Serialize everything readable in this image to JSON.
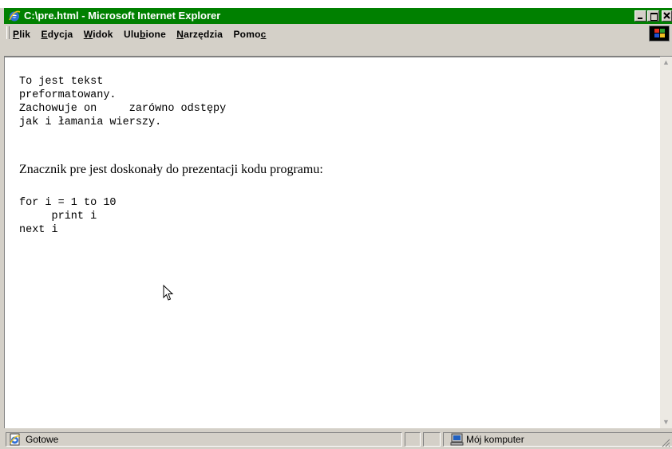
{
  "window": {
    "title": "C:\\pre.html - Microsoft Internet Explorer",
    "app_icon": "ie-icon",
    "caption_buttons": [
      "minimize-icon",
      "maximize-icon",
      "close-icon"
    ],
    "title_bar_color": "#008000"
  },
  "menubar": {
    "items": [
      {
        "label": "Plik",
        "mnemonic": "P"
      },
      {
        "label": "Edycja",
        "mnemonic": "E"
      },
      {
        "label": "Widok",
        "mnemonic": "W"
      },
      {
        "label": "Ulubione",
        "mnemonic": "b"
      },
      {
        "label": "Narzędzia",
        "mnemonic": "N"
      },
      {
        "label": "Pomoc",
        "mnemonic": "c"
      }
    ],
    "logo_icon": "windows-logo-icon"
  },
  "content": {
    "pre1": "To jest tekst\npreformatowany.\nZachowuje on     zarówno odstępy\njak i łamania wierszy.",
    "paragraph": "Znacznik pre jest doskonały do prezentacji kodu programu:",
    "pre2": "for i = 1 to 10\n     print i\nnext i"
  },
  "statusbar": {
    "status_text": "Gotowe",
    "status_icon": "ie-page-icon",
    "zone_icon": "my-computer-icon",
    "zone_text": "Mój komputer"
  }
}
